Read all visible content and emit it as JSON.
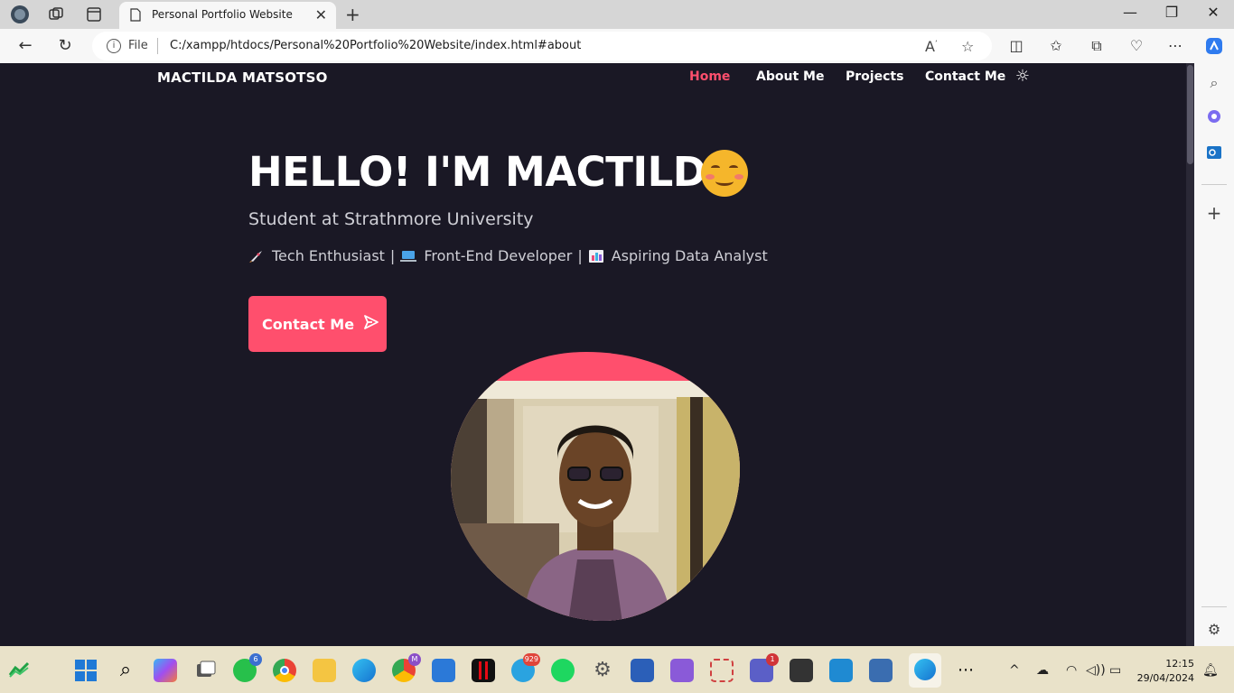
{
  "browser": {
    "tab_title": "Personal Portfolio Website",
    "address_scheme_label": "File",
    "url": "C:/xampp/htdocs/Personal%20Portfolio%20Website/index.html#about",
    "icons": {
      "back": "arrow-left-icon",
      "refresh": "refresh-icon",
      "read_aloud": "read-aloud-icon",
      "favorite": "star-icon",
      "split": "split-screen-icon",
      "favorites": "favorites-icon",
      "collections": "collections-icon",
      "performance": "heart-pulse-icon",
      "more": "more-icon",
      "copilot": "copilot-icon"
    }
  },
  "site": {
    "logo": "MACTILDA MATSOTSO",
    "nav": {
      "home": "Home",
      "about": "About Me",
      "projects": "Projects",
      "contact": "Contact Me"
    },
    "hero": {
      "title": "HELLO! I'M MACTILDA",
      "subtitle": "Student at Strathmore University",
      "tag1": "Tech Enthusiast",
      "tag2": "Front-End Developer",
      "tag3": "Aspiring Data Analyst",
      "cta": "Contact Me"
    }
  },
  "colors": {
    "page_bg": "#1a1825",
    "accent": "#ff4f6d",
    "text": "#ffffff",
    "muted": "#cfcfd6"
  },
  "taskbar": {
    "badges": {
      "whatsapp": "6",
      "chrome_profile": "M",
      "telegram": "929",
      "teams": "1"
    },
    "clock_time": "12:15",
    "clock_date": "29/04/2024"
  }
}
